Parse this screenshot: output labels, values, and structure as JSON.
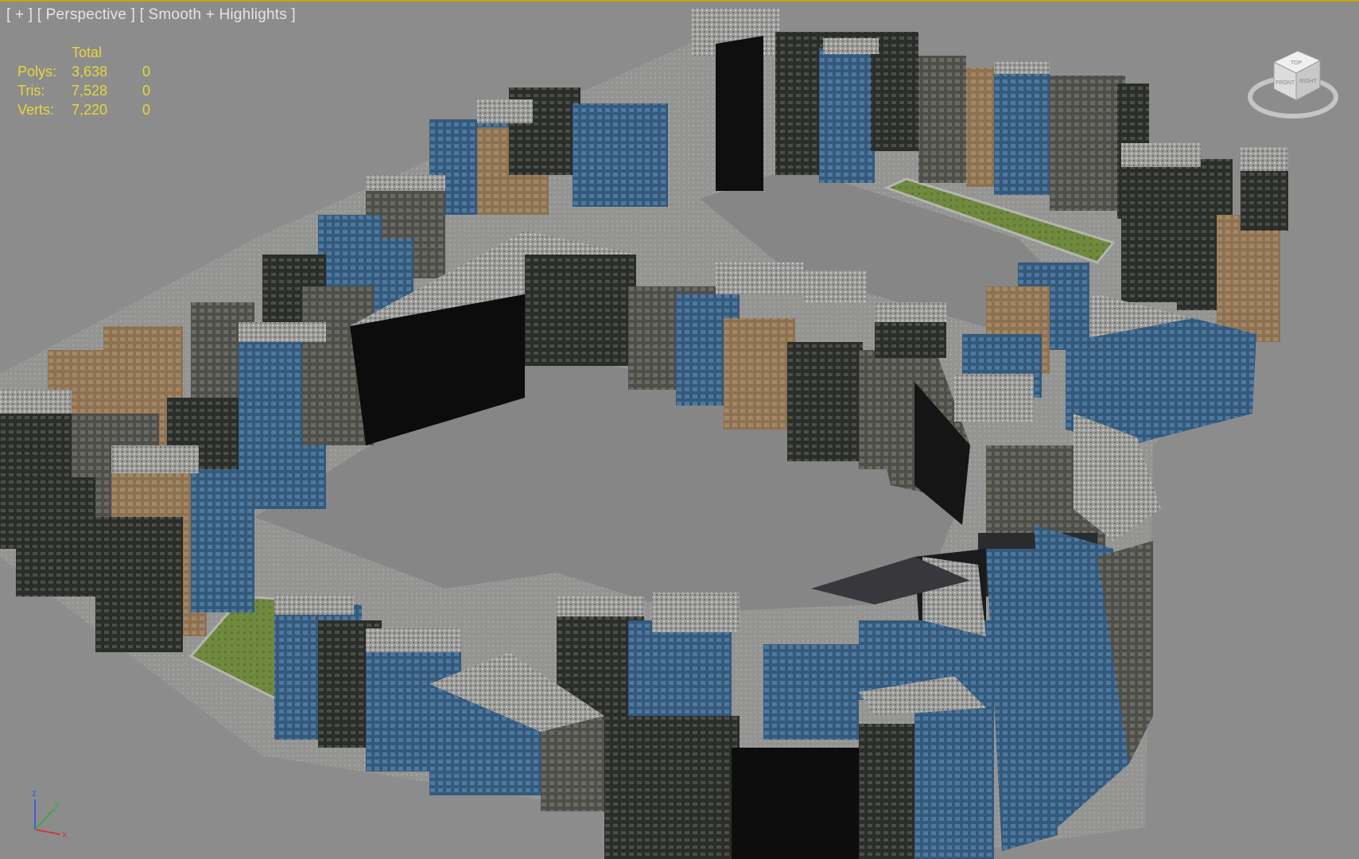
{
  "viewport": {
    "label": {
      "menu": "[ + ]",
      "view": "[ Perspective ]",
      "shading": "[ Smooth + Highlights ]"
    },
    "stats": {
      "header": "Total",
      "rows": [
        {
          "label": "Polys:",
          "total": "3,638",
          "selected": "0"
        },
        {
          "label": "Tris:",
          "total": "7,528",
          "selected": "0"
        },
        {
          "label": "Verts:",
          "total": "7,220",
          "selected": "0"
        }
      ]
    },
    "viewcube": {
      "icon": "viewcube-icon",
      "top_face": "TOP",
      "front_face": "FRONT",
      "right_face": "RIGHT"
    },
    "axis_gizmo": {
      "icon": "axis-tripod-icon",
      "x": "x",
      "y": "y",
      "z": "z"
    },
    "colors": {
      "background": "#8c8c8c",
      "stats_text": "#e8d63a",
      "active_border": "#c6a418"
    }
  }
}
